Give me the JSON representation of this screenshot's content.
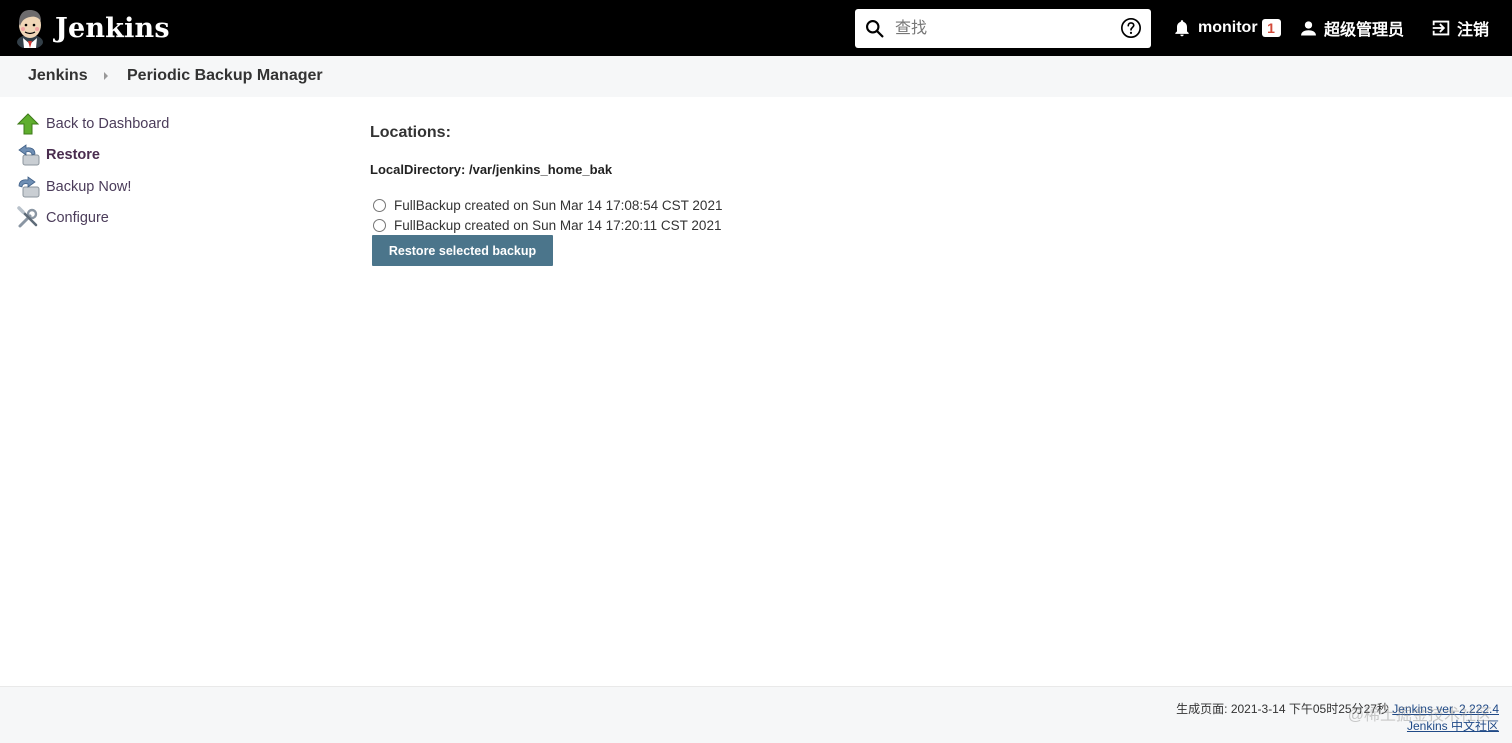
{
  "header": {
    "logo_text": "Jenkins",
    "search": {
      "placeholder": "查找",
      "value": ""
    },
    "notifications": {
      "label": "monitor",
      "count": "1"
    },
    "user": {
      "name": "超级管理员"
    },
    "logout": {
      "label": "注销"
    },
    "icons": [
      "jenkins-butler-logo",
      "search-icon",
      "help-icon",
      "bell-icon",
      "user-icon",
      "logout-icon"
    ]
  },
  "breadcrumb": {
    "items": [
      {
        "label": "Jenkins"
      },
      {
        "label": "Periodic Backup Manager"
      }
    ]
  },
  "sidebar": {
    "items": [
      {
        "label": "Back to Dashboard",
        "icon": "up-arrow-icon",
        "active": false
      },
      {
        "label": "Restore",
        "icon": "restore-icon",
        "active": true
      },
      {
        "label": "Backup Now!",
        "icon": "backup-icon",
        "active": false
      },
      {
        "label": "Configure",
        "icon": "configure-icon",
        "active": false
      }
    ]
  },
  "main": {
    "title": "Locations:",
    "local_directory": "LocalDirectory: /var/jenkins_home_bak",
    "backups": [
      {
        "label": "FullBackup created on Sun Mar 14 17:08:54 CST 2021",
        "selected": false
      },
      {
        "label": "FullBackup created on Sun Mar 14 17:20:11 CST 2021",
        "selected": false
      }
    ],
    "restore_button": "Restore selected backup"
  },
  "footer": {
    "generated": "生成页面: 2021-3-14 下午05时25分27秒",
    "version_link": "Jenkins ver. 2.222.4",
    "community_link": "Jenkins 中文社区",
    "watermark": "@稀土掘金技术社区"
  },
  "colors": {
    "header_bg": "#000000",
    "breadcrumb_bg": "#f6f7f8",
    "button_bg": "#4b758b",
    "badge_text": "#d24939",
    "sidebar_link": "#4b3c5a",
    "footer_link": "#204a87"
  }
}
